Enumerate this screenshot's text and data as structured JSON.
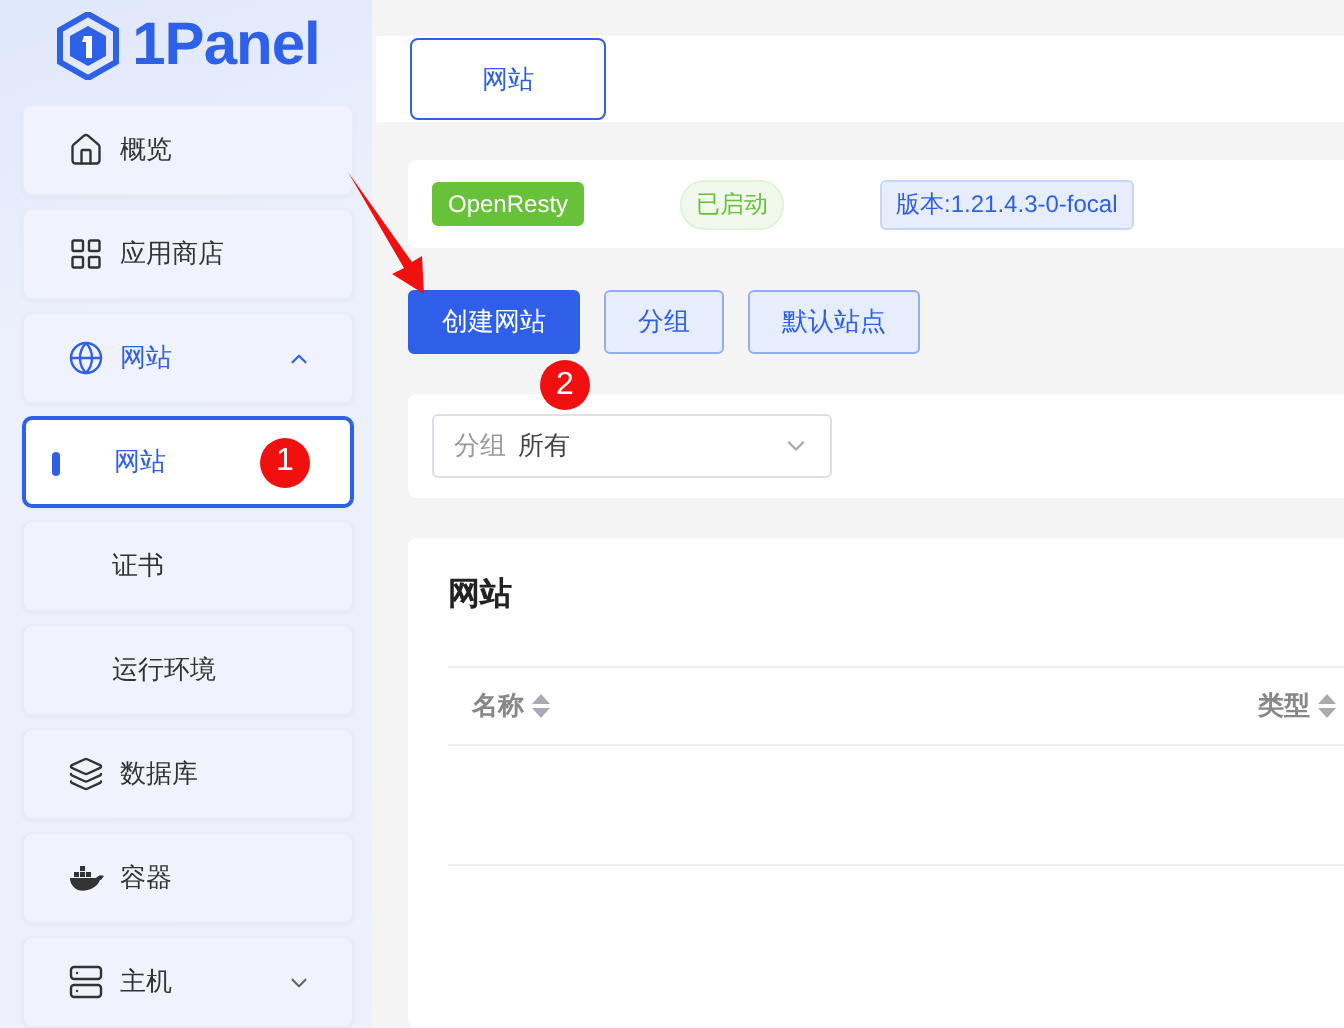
{
  "logo": {
    "text": "1Panel"
  },
  "nav": [
    {
      "kind": "item",
      "label": "概览",
      "selected": false
    },
    {
      "kind": "item",
      "label": "应用商店",
      "selected": false
    },
    {
      "kind": "group",
      "label": "网站",
      "expanded": true,
      "selected": true,
      "children": [
        {
          "label": "网站",
          "selected": true,
          "marker": "1"
        },
        {
          "label": "证书",
          "selected": false
        },
        {
          "label": "运行环境",
          "selected": false
        }
      ]
    },
    {
      "kind": "item",
      "label": "数据库",
      "selected": false
    },
    {
      "kind": "item",
      "label": "容器",
      "selected": false
    },
    {
      "kind": "group",
      "label": "主机",
      "expanded": false,
      "selected": false
    }
  ],
  "tabs": [
    {
      "label": "网站",
      "selected": true
    }
  ],
  "status": {
    "app": "OpenResty",
    "state": "已启动",
    "version": "版本:1.21.4.3-0-focal"
  },
  "actions": [
    {
      "label": "创建网站",
      "primary": true,
      "marker": "2"
    },
    {
      "label": "分组",
      "primary": false
    },
    {
      "label": "默认站点",
      "primary": false
    }
  ],
  "filter": {
    "label": "分组",
    "value": "所有"
  },
  "table": {
    "title": "网站",
    "columns": [
      "名称",
      "类型"
    ]
  }
}
